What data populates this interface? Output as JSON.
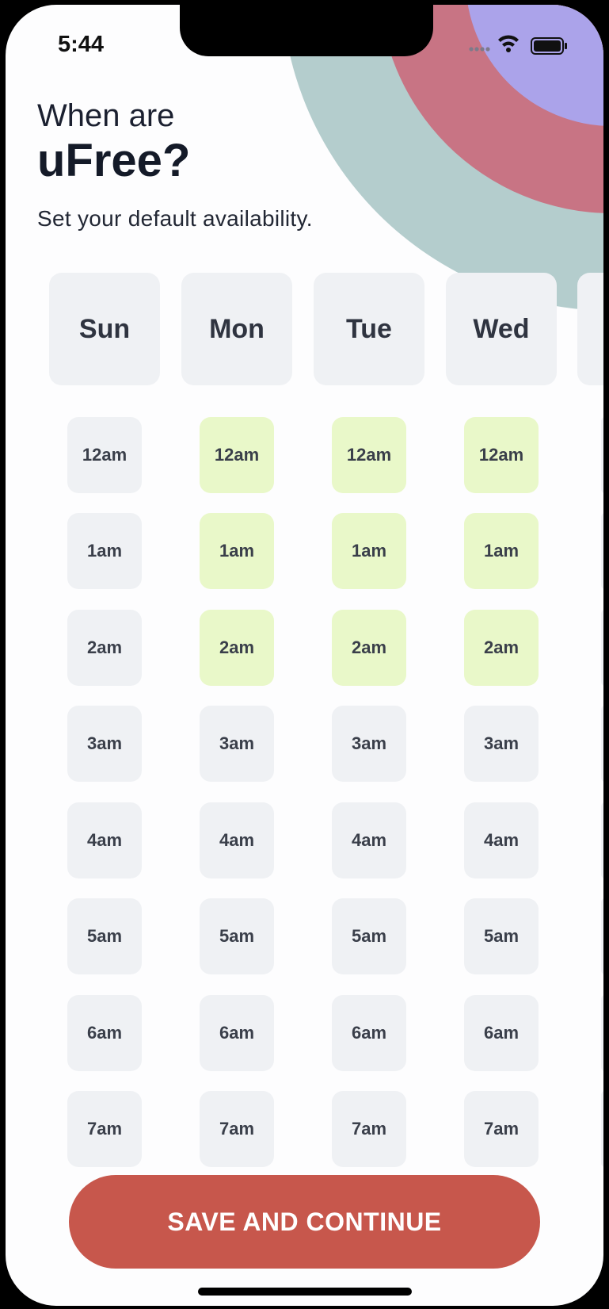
{
  "status_bar": {
    "time": "5:44"
  },
  "header": {
    "line1": "When are",
    "line2": "uFree?",
    "subtitle": "Set your default availability."
  },
  "colors": {
    "accent": "#c7574c",
    "available": "#e9f8c9",
    "unavailable": "#eff1f4",
    "decor_teal": "#b4cdcd",
    "decor_rose": "#c87484",
    "decor_lavender": "#aba3ea"
  },
  "days": [
    {
      "label": "Sun",
      "available": [
        false,
        false,
        false,
        false,
        false,
        false,
        false,
        false
      ]
    },
    {
      "label": "Mon",
      "available": [
        true,
        true,
        true,
        false,
        false,
        false,
        false,
        false
      ]
    },
    {
      "label": "Tue",
      "available": [
        true,
        true,
        true,
        false,
        false,
        false,
        false,
        false
      ]
    },
    {
      "label": "Wed",
      "available": [
        true,
        true,
        true,
        false,
        false,
        false,
        false,
        false
      ]
    }
  ],
  "times": [
    "12am",
    "1am",
    "2am",
    "3am",
    "4am",
    "5am",
    "6am",
    "7am"
  ],
  "actions": {
    "save_label": "SAVE AND CONTINUE"
  }
}
